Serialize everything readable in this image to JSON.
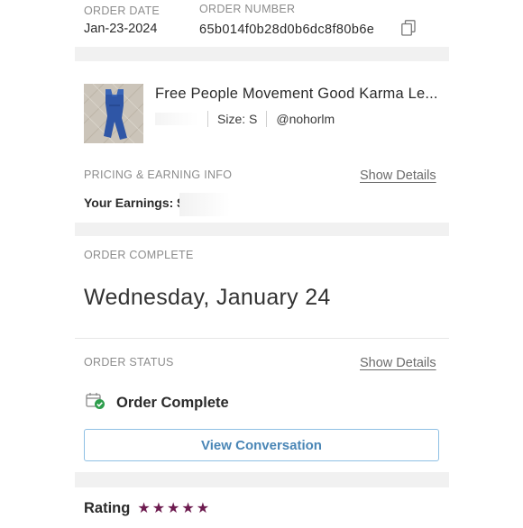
{
  "order": {
    "date_label": "ORDER DATE",
    "date_value": "Jan-23-2024",
    "number_label": "ORDER NUMBER",
    "number_value": "65b014f0b28d0b6dc8f80b6e"
  },
  "item": {
    "title": "Free People Movement Good Karma Le...",
    "size": "Size: S",
    "seller": "@nohorlm"
  },
  "pricing": {
    "label": "PRICING & EARNING INFO",
    "show_details": "Show Details",
    "earnings_label": "Your Earnings: $"
  },
  "completion": {
    "label": "ORDER COMPLETE",
    "date": "Wednesday, January 24"
  },
  "status": {
    "label": "ORDER STATUS",
    "show_details": "Show Details",
    "value": "Order Complete",
    "conversation_button": "View Conversation"
  },
  "rating": {
    "label": "Rating",
    "stars": 5,
    "star_glyph": "★"
  },
  "colors": {
    "star": "#6d1b4f",
    "link_button": "#4a86b6",
    "check": "#2e9e4d"
  }
}
